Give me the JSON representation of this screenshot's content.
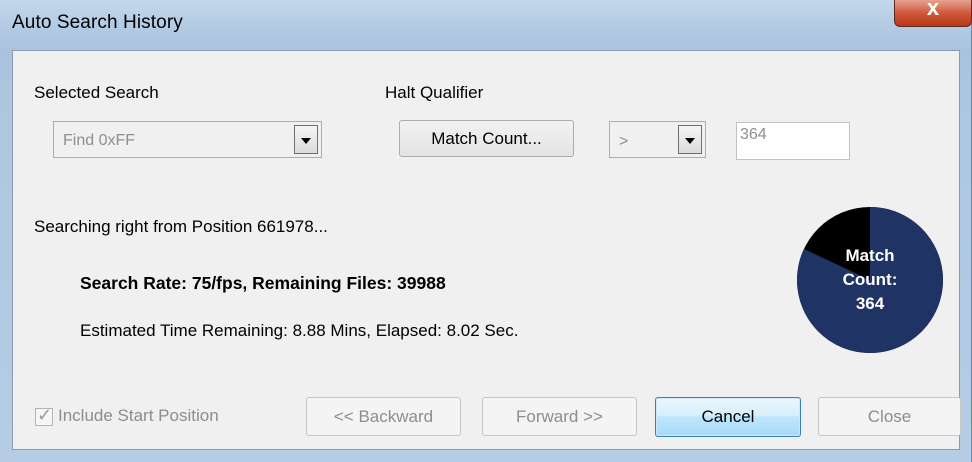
{
  "window": {
    "title": "Auto Search History",
    "close_label": "x"
  },
  "selected_search": {
    "label": "Selected Search",
    "value": "Find 0xFF"
  },
  "halt_qualifier": {
    "label": "Halt Qualifier",
    "button_label": "Match Count...",
    "operator_value": ">",
    "threshold_value": "364"
  },
  "status": {
    "searching": "Searching right from Position 661978...",
    "rate_line": "Search Rate: 75/fps,  Remaining Files: 39988",
    "time_line": "Estimated Time Remaining: 8.88 Mins, Elapsed: 8.02 Sec."
  },
  "progress_pie": {
    "line1": "Match",
    "line2": "Count:",
    "line3": "364",
    "completed_fraction": 0.82,
    "fill_color": "#1f3364",
    "remaining_color": "#000000"
  },
  "footer": {
    "include_start_label": "Include Start Position",
    "include_start_checked": true,
    "backward_label": "<< Backward",
    "forward_label": "Forward >>",
    "cancel_label": "Cancel",
    "close_label": "Close"
  }
}
